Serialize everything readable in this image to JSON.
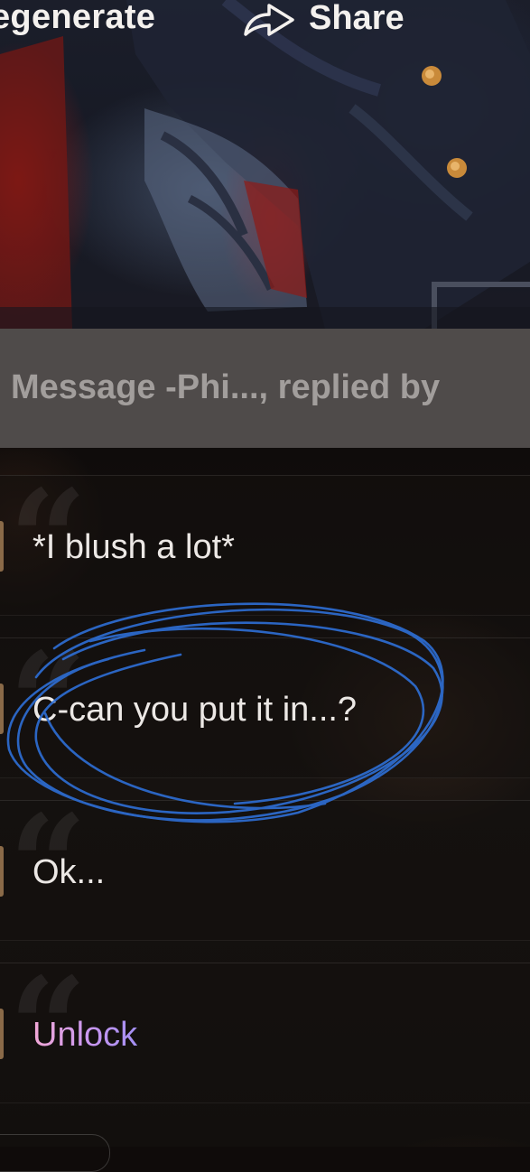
{
  "header": {
    "regenerate_label": "egenerate",
    "share_label": "Share"
  },
  "icons": {
    "share": "share-arrow-icon",
    "quote": "quote-mark-icon"
  },
  "message_bar": {
    "text": "Message -Phi..., replied by"
  },
  "options": [
    {
      "text": "*I blush a lot*",
      "locked": false
    },
    {
      "text": "C-can you put it in...?",
      "locked": false,
      "circled": true
    },
    {
      "text": "Ok...",
      "locked": false
    },
    {
      "text": "Unlock",
      "locked": true
    }
  ],
  "colors": {
    "unlock_gradient_start": "#f2a8d6",
    "unlock_gradient_end": "#a38ff2",
    "annotation_blue": "#2e6fd6"
  }
}
